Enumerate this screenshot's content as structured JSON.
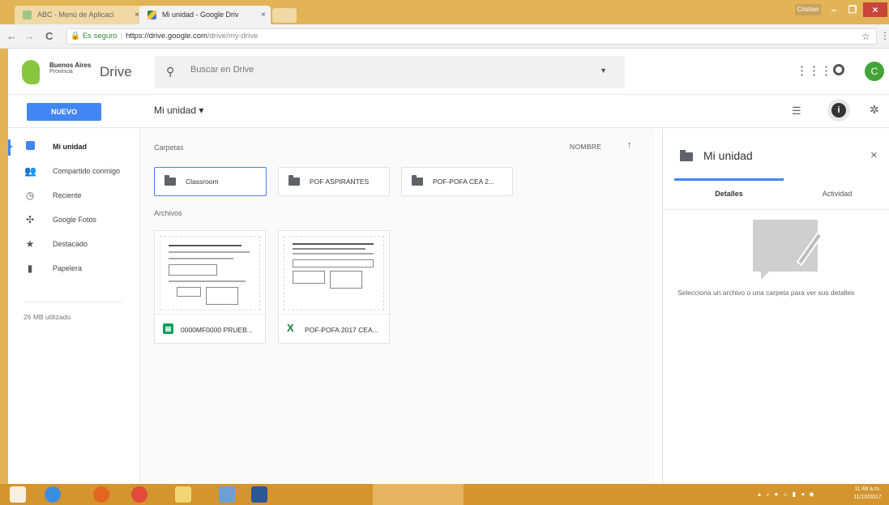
{
  "browser": {
    "tabs": [
      {
        "title": "ABC - Menú de Aplicaci",
        "close": "×"
      },
      {
        "title": "Mi unidad - Google Driv",
        "close": "×"
      }
    ],
    "user_badge": "Cristian",
    "window_controls": {
      "min": "–",
      "max": "❐",
      "close": "×"
    },
    "nav": {
      "back": "←",
      "forward": "→",
      "reload": "C"
    },
    "address": {
      "secure_label": "Es seguro",
      "host": "https://drive.google.com",
      "path": "/drive/my-drive"
    }
  },
  "drive": {
    "logo_line1": "Buenos Aires",
    "logo_line2": "Provincia",
    "product_name": "Drive",
    "search_placeholder": "Buscar en Drive",
    "avatar_letter": "C",
    "new_button": "NUEVO",
    "breadcrumb": "Mi unidad ▾",
    "sidebar": {
      "items": [
        {
          "label": "Mi unidad"
        },
        {
          "label": "Compartido conmigo"
        },
        {
          "label": "Reciente"
        },
        {
          "label": "Google Fotos"
        },
        {
          "label": "Destacado"
        },
        {
          "label": "Papelera"
        }
      ],
      "storage": "26 MB utilizado"
    },
    "main": {
      "folders_label": "Carpetas",
      "files_label": "Archivos",
      "sort_label": "NOMBRE",
      "sort_arrow": "↑",
      "folders": [
        {
          "name": "Classroom"
        },
        {
          "name": "POF ASPIRANTES"
        },
        {
          "name": "POF-POFA CEA 2..."
        }
      ],
      "files": [
        {
          "name": "0000MF0000 PRUEB...",
          "type_glyph": "▤"
        },
        {
          "name": "POF-POFA 2017 CEA...",
          "type_glyph": "X"
        }
      ]
    },
    "details": {
      "title": "Mi unidad",
      "close": "×",
      "tab_details": "Detalles",
      "tab_activity": "Actividad",
      "empty_message": "Selecciona un archivo o una carpeta para ver sus detalles"
    }
  },
  "taskbar": {
    "tray": "▴ ♪ ● ⌂ ▮ ◂ ◆",
    "time": "11:48 a.m.",
    "date": "11/10/2017"
  }
}
